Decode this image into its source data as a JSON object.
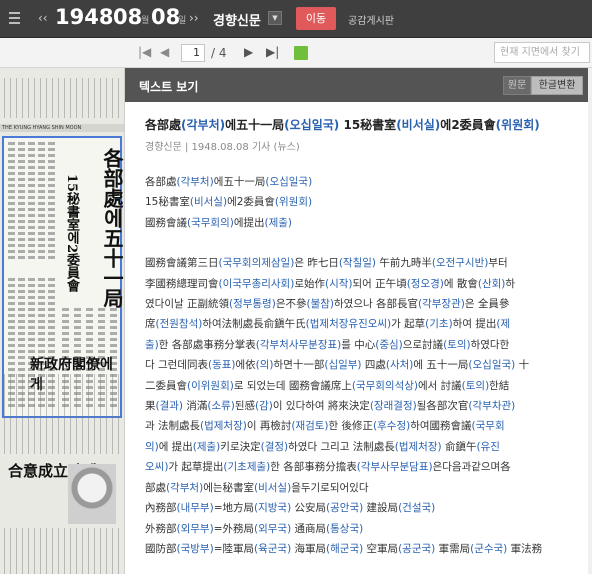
{
  "header": {
    "year": "1948",
    "month": "08",
    "month_unit": "월",
    "day": "08",
    "day_unit": "일",
    "nav_prev": "‹‹",
    "nav_next": "››",
    "newspaper": "경향신문",
    "go_label": "이동",
    "board_label": "공감게시판"
  },
  "pager": {
    "first": "|◀",
    "prev": "◀",
    "current_page": "1",
    "total": "/ 4",
    "next": "▶",
    "last": "▶|",
    "search_placeholder": "현재 지면에서 찾기"
  },
  "scan": {
    "masthead": "THE KYUNG HYANG SHIN MOON",
    "big_title": "各部處에五十一局",
    "subtitle": "15秘書室에2委員會",
    "lower_title": "新政府閣僚에게",
    "lower_title2": "合意成立時엔"
  },
  "panel": {
    "title": "텍스트 보기",
    "btn_original": "원문",
    "btn_korean": "한글변환"
  },
  "article": {
    "title_segments": [
      {
        "t": "各部處"
      },
      {
        "t": "(각부처)",
        "hl": true
      },
      {
        "t": "에五十一局"
      },
      {
        "t": "(오십일국)",
        "hl": true
      },
      {
        "t": " 15秘書室"
      },
      {
        "t": "(비서실)",
        "hl": true
      },
      {
        "t": "에2委員會"
      },
      {
        "t": "(위원회)",
        "hl": true
      }
    ],
    "meta": "경향신문 | 1948.08.08 기사 (뉴스)",
    "body": [
      [
        {
          "t": "各部處"
        },
        {
          "t": "(각부처)",
          "hl": true
        },
        {
          "t": "에五十一局"
        },
        {
          "t": "(오십일국)",
          "hl": true
        }
      ],
      [
        {
          "t": "15秘書室"
        },
        {
          "t": "(비서실)",
          "hl": true
        },
        {
          "t": "에2委員會"
        },
        {
          "t": "(위원회)",
          "hl": true
        }
      ],
      [
        {
          "t": "國務會議"
        },
        {
          "t": "(국무회의)",
          "hl": true
        },
        {
          "t": "에提出"
        },
        {
          "t": "(제출)",
          "hl": true
        }
      ],
      [],
      [
        {
          "t": "  國務會議第三日"
        },
        {
          "t": "(국무회의제삼일)",
          "hl": true
        },
        {
          "t": "은 昨七日"
        },
        {
          "t": "(작칠일)",
          "hl": true
        },
        {
          "t": " 午前九時半"
        },
        {
          "t": "(오전구시반)",
          "hl": true
        },
        {
          "t": "부터"
        }
      ],
      [
        {
          "t": "李國務總理司會"
        },
        {
          "t": "(이국무총리사회)",
          "hl": true
        },
        {
          "t": "로始作"
        },
        {
          "t": "(시작)",
          "hl": true
        },
        {
          "t": "되어 正午頃"
        },
        {
          "t": "(정오경)",
          "hl": true
        },
        {
          "t": "에 散會"
        },
        {
          "t": "(산회)",
          "hl": true
        },
        {
          "t": "하"
        }
      ],
      [
        {
          "t": "였다이날 正副統領"
        },
        {
          "t": "(정부통령)",
          "hl": true
        },
        {
          "t": "은不參"
        },
        {
          "t": "(불참)",
          "hl": true
        },
        {
          "t": "하였으나 各部長官"
        },
        {
          "t": "(각부장관)",
          "hl": true
        },
        {
          "t": "은 全員參"
        }
      ],
      [
        {
          "t": "席"
        },
        {
          "t": "(전원참석)",
          "hl": true
        },
        {
          "t": "하여法制處長俞鎭午氏"
        },
        {
          "t": "(법제처장유진오씨)",
          "hl": true
        },
        {
          "t": "가 起草"
        },
        {
          "t": "(기초)",
          "hl": true
        },
        {
          "t": "하여 提出"
        },
        {
          "t": "(제",
          "hl": true
        }
      ],
      [
        {
          "t": "출)",
          "hl": true
        },
        {
          "t": "한 各部處事務分掌表"
        },
        {
          "t": "(각부처사무분장표)",
          "hl": true
        },
        {
          "t": "를 中心"
        },
        {
          "t": "(중심)",
          "hl": true
        },
        {
          "t": "으로討議"
        },
        {
          "t": "(토의)",
          "hl": true
        },
        {
          "t": "하였다한"
        }
      ],
      [
        {
          "t": "다 그런데同表"
        },
        {
          "t": "(동표)",
          "hl": true
        },
        {
          "t": "에依"
        },
        {
          "t": "(의)",
          "hl": true
        },
        {
          "t": "하면十一部"
        },
        {
          "t": "(십일부)",
          "hl": true
        },
        {
          "t": " 四處"
        },
        {
          "t": "(사처)",
          "hl": true
        },
        {
          "t": "에 五十一局"
        },
        {
          "t": "(오십일국)",
          "hl": true
        },
        {
          "t": " 十"
        }
      ],
      [
        {
          "t": "二委員會"
        },
        {
          "t": "(이위원회)",
          "hl": true
        },
        {
          "t": "로 되었는데 國務會議席上"
        },
        {
          "t": "(국무회의석상)",
          "hl": true
        },
        {
          "t": "에서 討議"
        },
        {
          "t": "(토의)",
          "hl": true
        },
        {
          "t": "한結"
        }
      ],
      [
        {
          "t": "果"
        },
        {
          "t": "(결과)",
          "hl": true
        },
        {
          "t": " 消滿"
        },
        {
          "t": "(소류)",
          "hl": true
        },
        {
          "t": "된感"
        },
        {
          "t": "(감)",
          "hl": true
        },
        {
          "t": "이 있다하여 將來決定"
        },
        {
          "t": "(장래결정)",
          "hl": true
        },
        {
          "t": "될各部次官"
        },
        {
          "t": "(각부차관)",
          "hl": true
        }
      ],
      [
        {
          "t": "과 法制處長"
        },
        {
          "t": "(법제처장)",
          "hl": true
        },
        {
          "t": "이 再檢討"
        },
        {
          "t": "(재검토)",
          "hl": true
        },
        {
          "t": "한 後修正"
        },
        {
          "t": "(후수정)",
          "hl": true
        },
        {
          "t": "하여國務會議"
        },
        {
          "t": "(국무회",
          "hl": true
        }
      ],
      [
        {
          "t": "의)",
          "hl": true
        },
        {
          "t": "에 提出"
        },
        {
          "t": "(제출)",
          "hl": true
        },
        {
          "t": "키로決定"
        },
        {
          "t": "(결정)",
          "hl": true
        },
        {
          "t": "하였다 그리고 法制處長"
        },
        {
          "t": "(법제처장)",
          "hl": true
        },
        {
          "t": " 俞鎭午"
        },
        {
          "t": "(유진",
          "hl": true
        }
      ],
      [
        {
          "t": "오씨)",
          "hl": true
        },
        {
          "t": "가 起草提出"
        },
        {
          "t": "(기초제출)",
          "hl": true
        },
        {
          "t": "한 各部事務分擔表"
        },
        {
          "t": "(각부사무분담표)",
          "hl": true
        },
        {
          "t": "은다음과같으며各"
        }
      ],
      [
        {
          "t": "部處"
        },
        {
          "t": "(각부처)",
          "hl": true
        },
        {
          "t": "에는秘書室"
        },
        {
          "t": "(비서실)",
          "hl": true
        },
        {
          "t": "을두기로되어있다"
        }
      ],
      [
        {
          "t": "內務部"
        },
        {
          "t": "(내무부)",
          "hl": true
        },
        {
          "t": "=地方局"
        },
        {
          "t": "(지방국)",
          "hl": true
        },
        {
          "t": " 公安局"
        },
        {
          "t": "(공안국)",
          "hl": true
        },
        {
          "t": " 建設局"
        },
        {
          "t": "(건설국)",
          "hl": true
        }
      ],
      [
        {
          "t": "外務部"
        },
        {
          "t": "(외무부)",
          "hl": true
        },
        {
          "t": "=外務局"
        },
        {
          "t": "(외무국)",
          "hl": true
        },
        {
          "t": " 通商局"
        },
        {
          "t": "(통상국)",
          "hl": true
        }
      ],
      [
        {
          "t": "國防部"
        },
        {
          "t": "(국방부)",
          "hl": true
        },
        {
          "t": "=陸軍局"
        },
        {
          "t": "(육군국)",
          "hl": true
        },
        {
          "t": " 海軍局"
        },
        {
          "t": "(해군국)",
          "hl": true
        },
        {
          "t": " 空軍局"
        },
        {
          "t": "(공군국)",
          "hl": true
        },
        {
          "t": " 軍需局"
        },
        {
          "t": "(군수국)",
          "hl": true
        },
        {
          "t": " 軍法務"
        }
      ]
    ]
  },
  "colors": {
    "topbar": "#3f3f3f",
    "go_button": "#e05a5c",
    "fullscreen_button": "#6fbf3b",
    "highlight_text": "#2b62b0",
    "selection_box": "#4a7ad8"
  }
}
